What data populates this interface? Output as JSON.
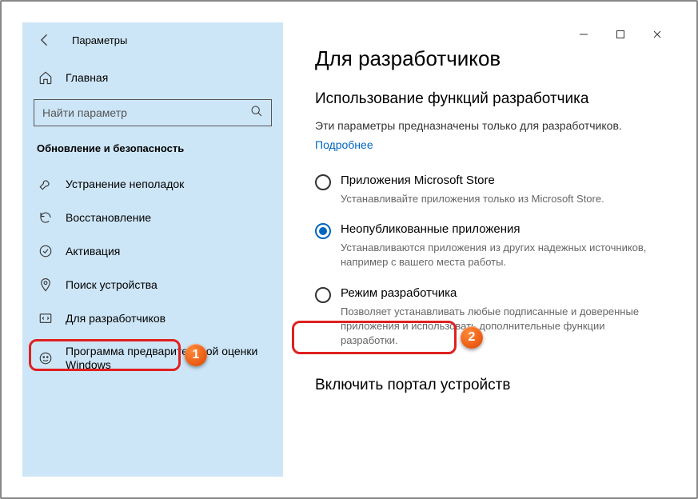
{
  "window": {
    "title": "Параметры"
  },
  "sidebar": {
    "home": "Главная",
    "search_placeholder": "Найти параметр",
    "section": "Обновление и безопасность",
    "items": [
      {
        "id": "troubleshoot",
        "label": "Устранение неполадок"
      },
      {
        "id": "recovery",
        "label": "Восстановление"
      },
      {
        "id": "activation",
        "label": "Активация"
      },
      {
        "id": "find-device",
        "label": "Поиск устройства"
      },
      {
        "id": "for-developers",
        "label": "Для разработчиков"
      },
      {
        "id": "insider",
        "label": "Программа предварительной оценки Windows"
      }
    ]
  },
  "content": {
    "title": "Для разработчиков",
    "subhead": "Использование функций разработчика",
    "desc": "Эти параметры предназначены только для разработчиков.",
    "more": "Подробнее",
    "options": [
      {
        "id": "store",
        "label": "Приложения Microsoft Store",
        "help": "Устанавливайте приложения только из Microsoft Store.",
        "selected": false
      },
      {
        "id": "sideload",
        "label": "Неопубликованные приложения",
        "help": "Устанавливаются приложения из других надежных источников, например с вашего места работы.",
        "selected": true
      },
      {
        "id": "devmode",
        "label": "Режим разработчика",
        "help": "Позволяет устанавливать любые подписанные и доверенные приложения и использовать дополнительные функции разработки.",
        "selected": false
      }
    ],
    "section2": "Включить портал устройств"
  },
  "annotations": {
    "1": "1",
    "2": "2"
  }
}
